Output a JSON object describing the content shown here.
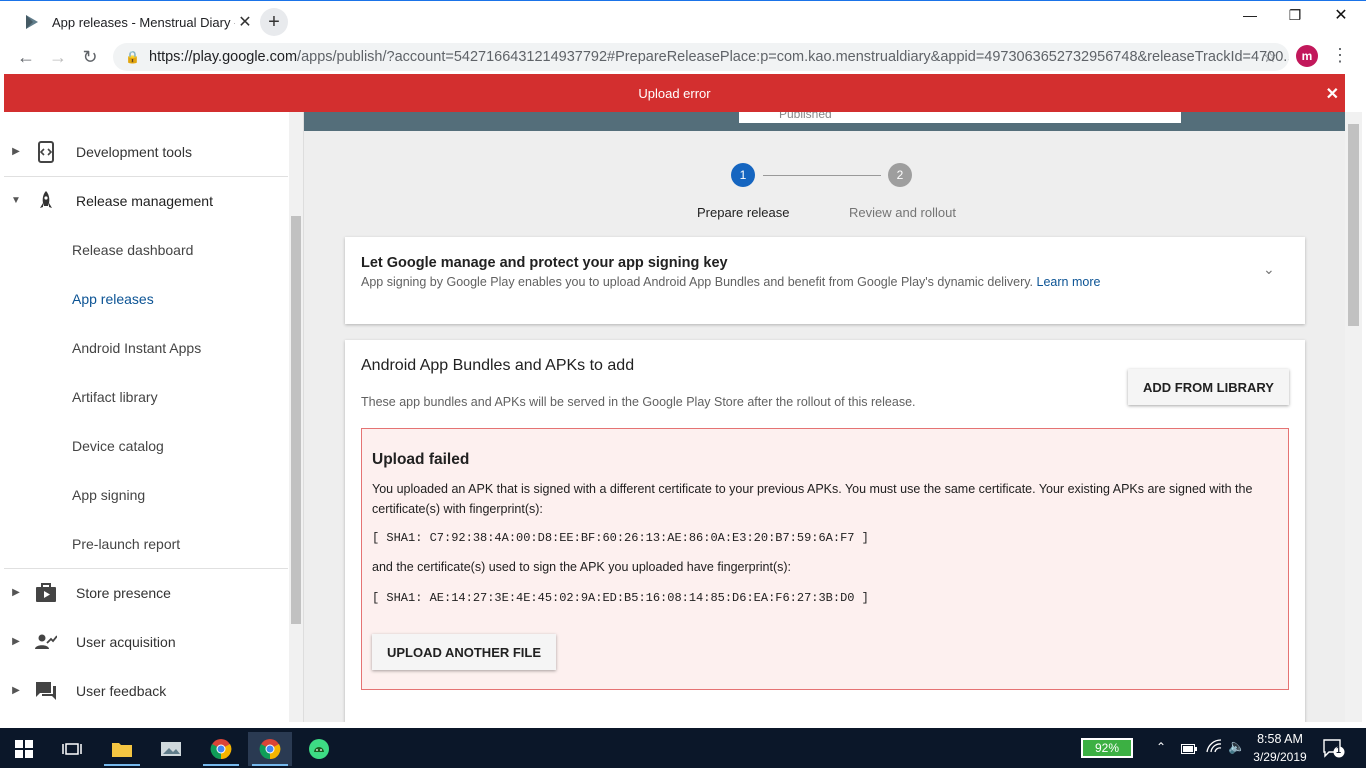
{
  "browser": {
    "tab_title": "App releases - Menstrual Diary - ",
    "tab_close": "✕",
    "new_tab": "+",
    "url_host": "https://play.google.com",
    "url_path": "/apps/publish/?account=5427166431214937792#PrepareReleasePlace:p=com.kao.menstrualdiary&appid=4973063652732956748&releaseTrackId=4700...",
    "avatar_letter": "m"
  },
  "banner": {
    "text": "Upload error",
    "close": "✕"
  },
  "header": {
    "status": "Published"
  },
  "sidebar": {
    "top_items": [
      {
        "label": "Development tools",
        "icon": "code-icon"
      },
      {
        "label": "Release management",
        "icon": "rocket-icon"
      }
    ],
    "sub_items": [
      {
        "label": "Release dashboard"
      },
      {
        "label": "App releases"
      },
      {
        "label": "Android Instant Apps"
      },
      {
        "label": "Artifact library"
      },
      {
        "label": "Device catalog"
      },
      {
        "label": "App signing"
      },
      {
        "label": "Pre-launch report"
      }
    ],
    "bottom_items": [
      {
        "label": "Store presence",
        "icon": "store-icon"
      },
      {
        "label": "User acquisition",
        "icon": "user-growth-icon"
      },
      {
        "label": "User feedback",
        "icon": "feedback-icon"
      }
    ]
  },
  "stepper": {
    "steps": [
      {
        "num": "1",
        "label": "Prepare release"
      },
      {
        "num": "2",
        "label": "Review and rollout"
      }
    ],
    "active_color": "#1565c0",
    "inactive_color": "#9e9e9e"
  },
  "signing_card": {
    "title": "Let Google manage and protect your app signing key",
    "desc": "App signing by Google Play enables you to upload Android App Bundles and benefit from Google Play's dynamic delivery.",
    "learn_more": "Learn more"
  },
  "bundles_card": {
    "title": "Android App Bundles and APKs to add",
    "desc": "These app bundles and APKs will be served in the Google Play Store after the rollout of this release.",
    "add_button": "ADD FROM LIBRARY",
    "error": {
      "title": "Upload failed",
      "message": "You uploaded an APK that is signed with a different certificate to your previous APKs. You must use the same certificate. Your existing APKs are signed with the certificate(s) with fingerprint(s):",
      "fingerprint_existing": "[ SHA1: C7:92:38:4A:00:D8:EE:BF:60:26:13:AE:86:0A:E3:20:B7:59:6A:F7 ]",
      "message2": "and the certificate(s) used to sign the APK you uploaded have fingerprint(s):",
      "fingerprint_uploaded": "[ SHA1: AE:14:27:3E:4E:45:02:9A:ED:B5:16:08:14:85:D6:EA:F6:27:3B:D0 ]",
      "upload_button": "UPLOAD ANOTHER FILE"
    }
  },
  "taskbar": {
    "battery": "92%",
    "time": "8:58 AM",
    "date": "3/29/2019",
    "notifications": "1"
  },
  "colors": {
    "banner": "#d32f2f",
    "accent": "#1565c0",
    "taskbar": "#0b1729"
  }
}
